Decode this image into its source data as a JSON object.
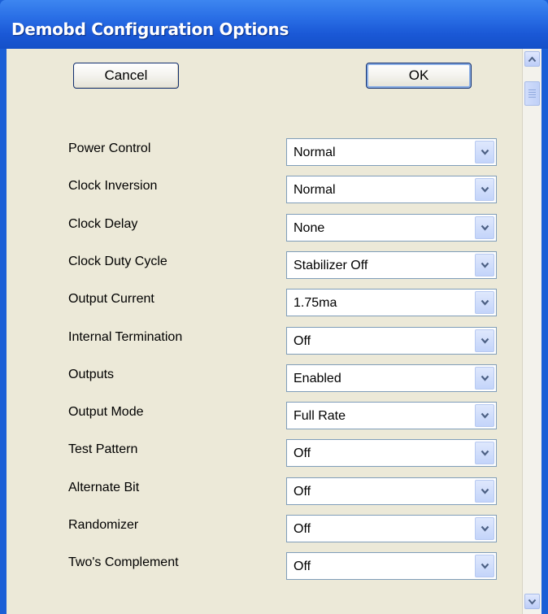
{
  "window": {
    "title": "Demobd Configuration Options"
  },
  "buttons": {
    "cancel_label": "Cancel",
    "ok_label": "OK"
  },
  "options": [
    {
      "label": "Power Control",
      "value": "Normal"
    },
    {
      "label": "Clock Inversion",
      "value": "Normal"
    },
    {
      "label": "Clock Delay",
      "value": "None"
    },
    {
      "label": "Clock Duty Cycle",
      "value": "Stabilizer Off"
    },
    {
      "label": "Output Current",
      "value": "1.75ma"
    },
    {
      "label": "Internal Termination",
      "value": "Off"
    },
    {
      "label": "Outputs",
      "value": "Enabled"
    },
    {
      "label": "Output Mode",
      "value": "Full Rate"
    },
    {
      "label": "Test Pattern",
      "value": "Off"
    },
    {
      "label": "Alternate Bit",
      "value": "Off"
    },
    {
      "label": "Randomizer",
      "value": "Off"
    },
    {
      "label": "Two's Complement",
      "value": "Off"
    }
  ],
  "icons": {
    "dropdown": "chevron-down-icon",
    "scroll_up": "arrow-up-icon",
    "scroll_down": "arrow-down-icon"
  },
  "colors": {
    "titlebar": "#2a6fe6",
    "dialog_background": "#ece9d8",
    "field_border": "#7f9db9"
  }
}
